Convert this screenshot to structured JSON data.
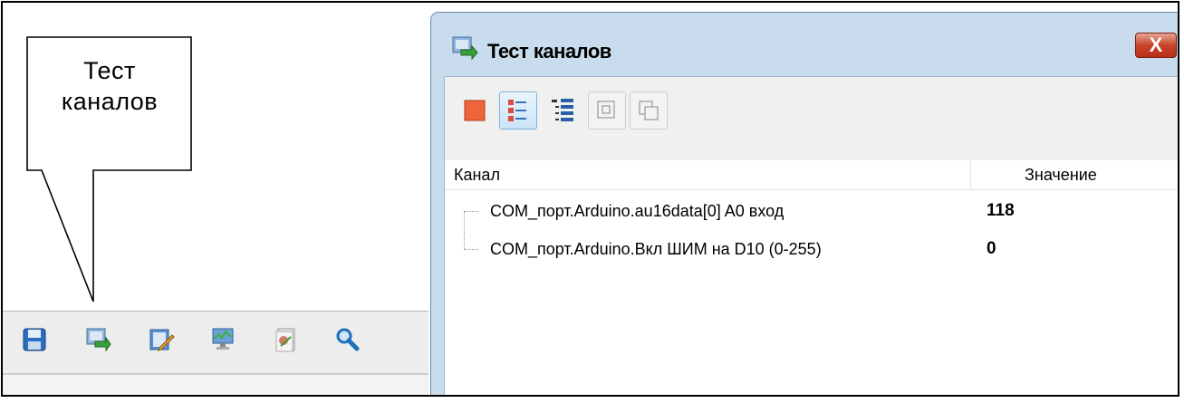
{
  "callout": {
    "line1": "Тест",
    "line2": "каналов"
  },
  "left_toolbar": {
    "icons": [
      "save-icon",
      "channel-test-icon",
      "edit-icon",
      "monitor-icon",
      "document-icon",
      "search-icon"
    ]
  },
  "dialog": {
    "title": "Тест каналов",
    "close_label": "X",
    "toolbar": {
      "buttons": [
        "stop-button",
        "list-view-button",
        "tree-view-button",
        "copy-button",
        "paste-button"
      ]
    },
    "columns": {
      "channel": "Канал",
      "value": "Значение"
    },
    "rows": [
      {
        "name": "COM_порт.Arduino.au16data[0]  A0 вход",
        "value": "118"
      },
      {
        "name": "COM_порт.Arduino.Вкл ШИМ на D10 (0-255)",
        "value": "0"
      }
    ]
  },
  "colors": {
    "titlebar": "#c9dced",
    "close": "#c9442c",
    "stop": "#f0643a"
  }
}
